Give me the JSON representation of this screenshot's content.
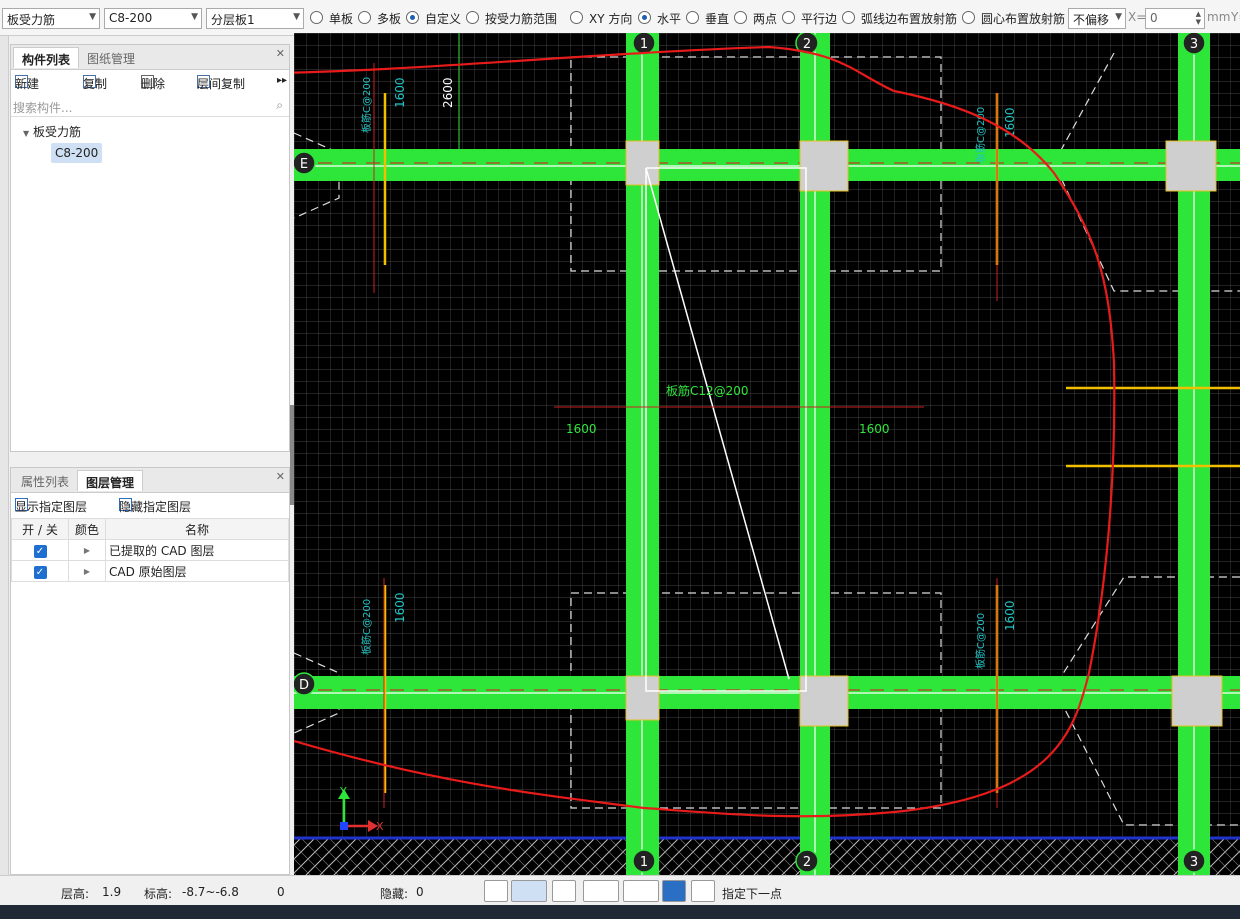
{
  "toolbar": {
    "category_select": "板受力筋",
    "spec_select": "C8-200",
    "layer_select": "分层板1",
    "radio_single": "单板",
    "radio_multi": "多板",
    "radio_custom": "自定义",
    "radio_range": "按受力筋范围",
    "radio_xy": "XY 方向",
    "radio_horizontal": "水平",
    "radio_vertical": "垂直",
    "radio_twopoint": "两点",
    "radio_parallel": "平行边",
    "radio_arc": "弧线边布置放射筋",
    "radio_center": "圆心布置放射筋",
    "offset_select": "不偏移",
    "x_label": "X=",
    "x_value": "0",
    "unit": "mm",
    "y_label": "Y="
  },
  "component_panel": {
    "tab_list": "构件列表",
    "tab_drawing": "图纸管理",
    "btn_new": "新建",
    "btn_copy": "复制",
    "btn_delete": "删除",
    "btn_floor_copy": "层间复制",
    "search_placeholder": "搜索构件...",
    "tree_root": "板受力筋",
    "tree_leaf": "C8-200"
  },
  "layer_panel": {
    "tab_props": "属性列表",
    "tab_layers": "图层管理",
    "btn_show": "显示指定图层",
    "btn_hide": "隐藏指定图层",
    "col_toggle": "开 / 关",
    "col_color": "颜色",
    "col_name": "名称",
    "rows": [
      {
        "name": "已提取的 CAD 图层",
        "checked": true
      },
      {
        "name": "CAD 原始图层",
        "checked": true
      }
    ]
  },
  "canvas": {
    "axis_labels": [
      "1",
      "2",
      "3",
      "E",
      "D"
    ],
    "dim_2600": "2600",
    "dim_1600": "1600",
    "rebar_label": "板筋C12@200",
    "rebar_label_short": "板筋C@200",
    "y_axis": "Y",
    "x_axis": "X"
  },
  "status": {
    "floor_height_label": "层高:",
    "floor_height": "1.9",
    "elevation_label": "标高:",
    "elevation": "-8.7~-6.8",
    "count": "0",
    "hidden_label": "隐藏:",
    "hidden": "0",
    "hint": "指定下一点"
  }
}
